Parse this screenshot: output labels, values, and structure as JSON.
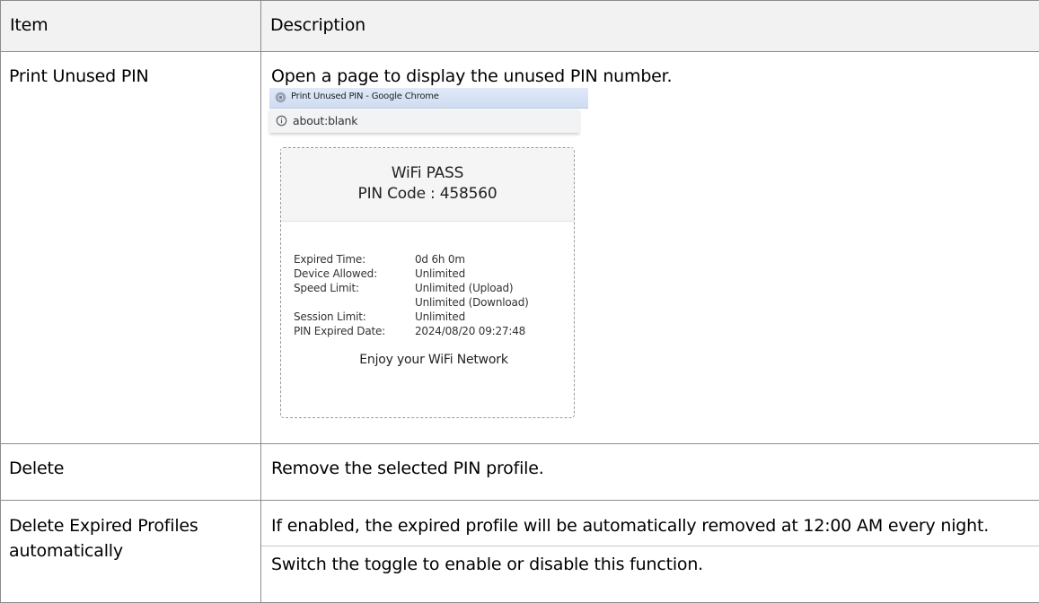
{
  "table": {
    "header": {
      "item": "Item",
      "description": "Description"
    },
    "rows": [
      {
        "item": "Print Unused PIN",
        "description": "Open a page to display the unused PIN number."
      },
      {
        "item": "Delete",
        "description": "Remove the selected PIN profile."
      },
      {
        "item_line1": "Delete Expired Profiles",
        "item_line2": "automatically",
        "description": "If enabled, the expired profile will be automatically removed at 12:00 AM every night.",
        "description_2": "Switch the toggle to enable or disable this function."
      }
    ]
  },
  "screenshot": {
    "window_title": "Print Unused PIN - Google Chrome",
    "address": "about:blank",
    "icons": {
      "browser": "chrome-logo-icon",
      "address": "info-icon"
    },
    "pass": {
      "title": "WiFi PASS",
      "pin_line": "PIN Code : 458560",
      "details": [
        {
          "key": "Expired Time:",
          "value": "0d 6h 0m"
        },
        {
          "key": "Device Allowed:",
          "value": "Unlimited"
        },
        {
          "key": "Speed Limit:",
          "value": "Unlimited (Upload)"
        },
        {
          "key": "",
          "value": "Unlimited (Download)"
        },
        {
          "key": "Session Limit:",
          "value": "Unlimited"
        },
        {
          "key": "PIN Expired Date:",
          "value": "2024/08/20 09:27:48"
        }
      ],
      "footer": "Enjoy your WiFi Network"
    }
  }
}
